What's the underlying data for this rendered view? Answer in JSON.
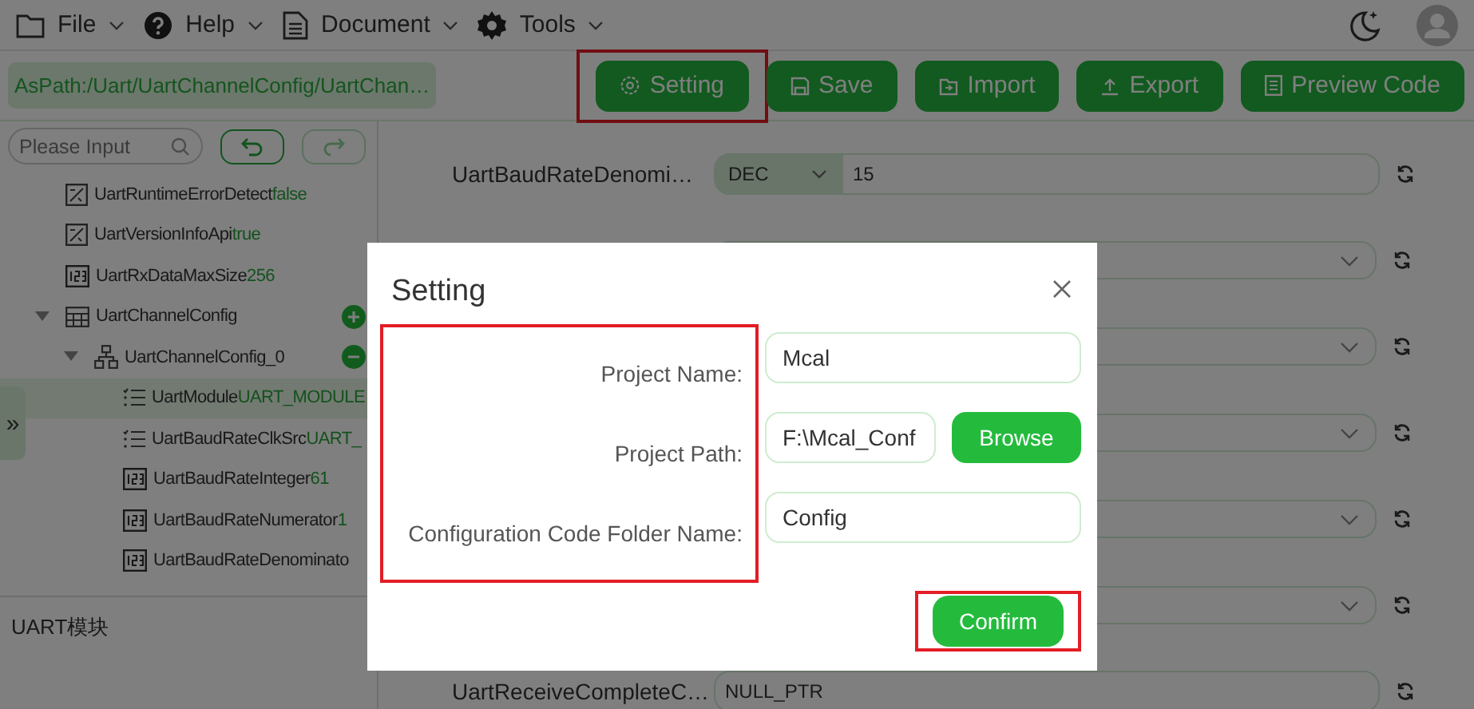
{
  "menu": [
    {
      "label": "File"
    },
    {
      "label": "Help"
    },
    {
      "label": "Document"
    },
    {
      "label": "Tools"
    }
  ],
  "toolbar": {
    "path": "AsPath:/Uart/UartChannelConfig/UartChan…",
    "buttons": [
      {
        "label": "Setting",
        "highlighted": true
      },
      {
        "label": "Save",
        "highlighted": false
      },
      {
        "label": "Import",
        "highlighted": false
      },
      {
        "label": "Export",
        "highlighted": false
      },
      {
        "label": "Preview Code",
        "highlighted": false
      }
    ]
  },
  "search": {
    "placeholder": "Please Input"
  },
  "tree": [
    {
      "label": "UartRuntimeErrorDetect",
      "value": "false",
      "kind": "boolean",
      "selected": false
    },
    {
      "label": "UartVersionInfoApi",
      "value": "true",
      "kind": "boolean",
      "selected": false
    },
    {
      "label": "UartRxDataMaxSize",
      "value": "256",
      "kind": "integer",
      "selected": false
    },
    {
      "label": "UartChannelConfig",
      "kind": "table",
      "addable": true,
      "expanded": true,
      "selected": false,
      "children": [
        {
          "label": "UartChannelConfig_0",
          "kind": "container",
          "removable": true,
          "expanded": true,
          "selected": false,
          "children": [
            {
              "label": "UartModule",
              "value": "UART_MODULE",
              "kind": "enum",
              "selected": true
            },
            {
              "label": "UartBaudRateClkSrc",
              "value": "UART_",
              "kind": "enum",
              "selected": false
            },
            {
              "label": "UartBaudRateInteger",
              "value": "61",
              "kind": "integer",
              "selected": false
            },
            {
              "label": "UartBaudRateNumerator",
              "value": "1",
              "kind": "integer",
              "selected": false
            },
            {
              "label": "UartBaudRateDenominato",
              "kind": "integer",
              "selected": false
            }
          ]
        }
      ]
    }
  ],
  "side_handle": "»",
  "description": "UART模块",
  "params": [
    {
      "kind": "number",
      "label": "UartBaudRateDenomi…",
      "format": "DEC",
      "value": "15"
    },
    {
      "kind": "select"
    },
    {
      "kind": "select"
    },
    {
      "kind": "select"
    },
    {
      "kind": "select"
    },
    {
      "kind": "select"
    },
    {
      "kind": "text",
      "label": "UartReceiveCompleteC…",
      "value": "NULL_PTR"
    }
  ],
  "dialog": {
    "title": "Setting",
    "labels_highlighted": true,
    "fields": [
      {
        "label": "Project Name:",
        "value": "Mcal"
      },
      {
        "label": "Project Path:",
        "value": "F:\\Mcal_Conf",
        "button": "Browse"
      },
      {
        "label": "Configuration Code Folder Name:",
        "value": "Config"
      }
    ],
    "confirm": {
      "label": "Confirm",
      "highlighted": true
    }
  }
}
